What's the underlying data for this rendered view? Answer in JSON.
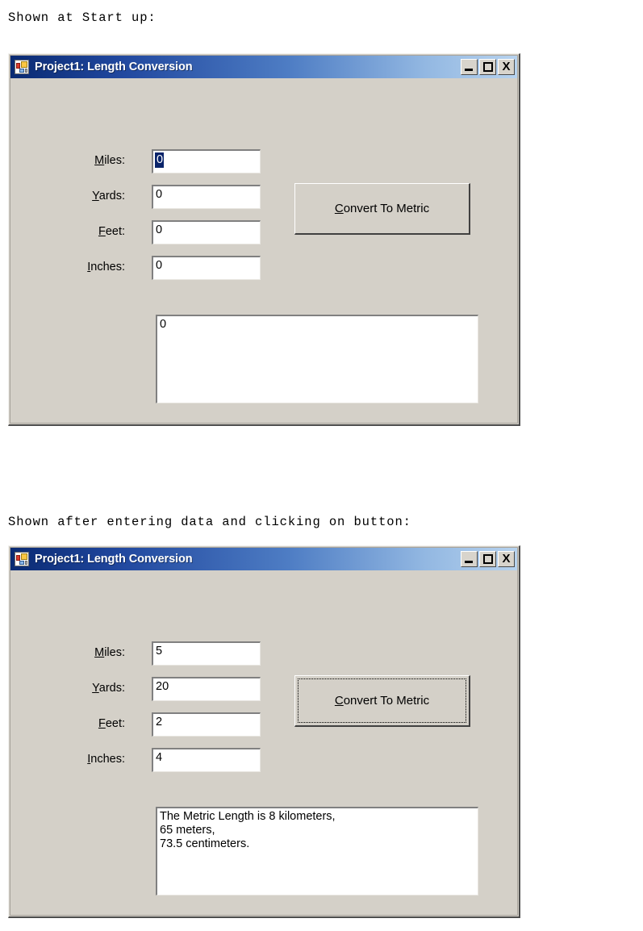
{
  "document": {
    "caption_startup": "Shown at Start up:",
    "caption_after": "Shown after entering data and clicking on button:"
  },
  "colors": {
    "form_face": "#d4d0c8",
    "title_gradient_start": "#0a2a72",
    "title_gradient_end": "#b6d2ee",
    "title_text": "#ffffff",
    "selection_highlight": "#0a246a",
    "textbox_background": "#ffffff",
    "text": "#000000"
  },
  "window": {
    "title": "Project1: Length Conversion",
    "icon": "vb-form-icon",
    "buttons": {
      "minimize_label": "_",
      "maximize_label": "□",
      "close_label": "X"
    }
  },
  "labels": {
    "miles": {
      "accel": "M",
      "rest": "iles:"
    },
    "yards": {
      "accel": "Y",
      "rest": "ards:"
    },
    "feet": {
      "accel": "F",
      "rest": "eet:"
    },
    "inches": {
      "accel": "I",
      "rest": "nches:"
    }
  },
  "button": {
    "accel": "C",
    "rest": "onvert To Metric",
    "full_label": "Convert To Metric"
  },
  "forms": [
    {
      "state": "startup",
      "fields": {
        "miles": "0",
        "yards": "0",
        "feet": "0",
        "inches": "0"
      },
      "miles_selected": true,
      "output": "0",
      "button_focused": false
    },
    {
      "state": "after-convert",
      "fields": {
        "miles": "5",
        "yards": "20",
        "feet": "2",
        "inches": "4"
      },
      "miles_selected": false,
      "output": "The Metric Length is 8 kilometers,\n65 meters,\n73.5 centimeters.",
      "button_focused": true
    }
  ]
}
